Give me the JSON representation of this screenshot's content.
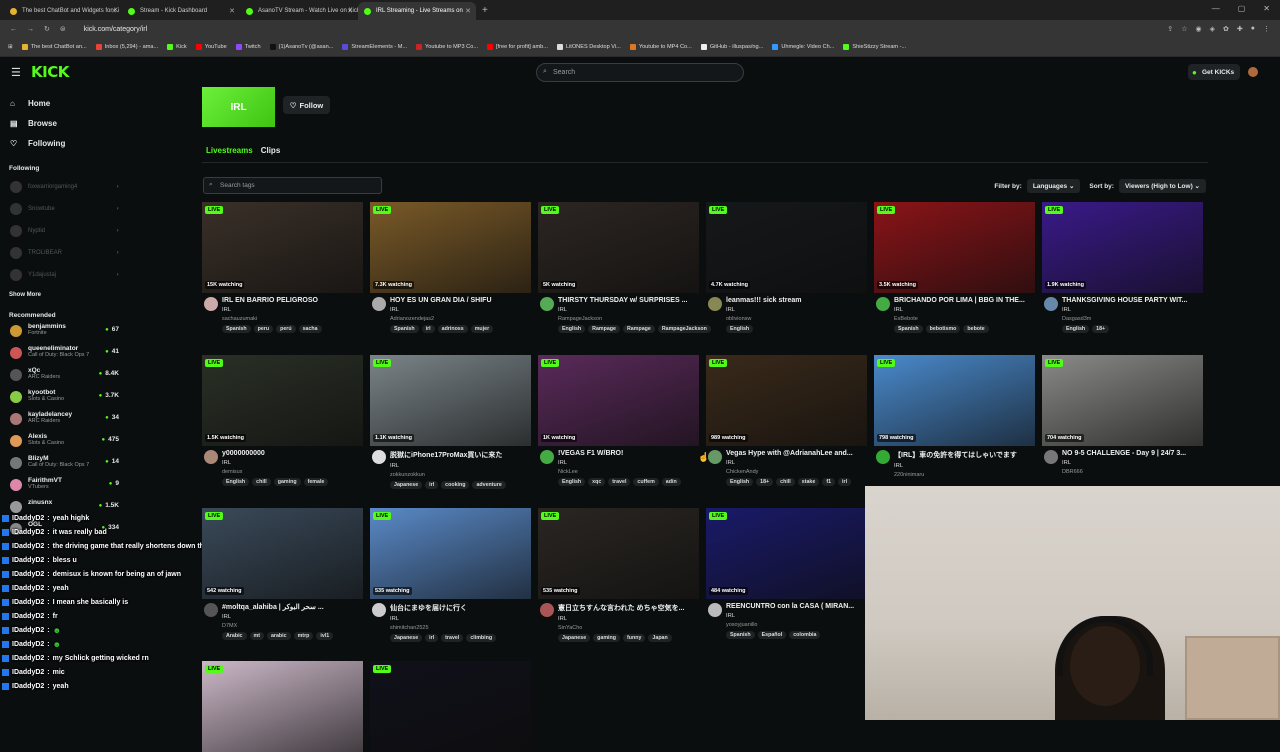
{
  "browser": {
    "tabs": [
      {
        "label": "The best ChatBot and Widgets for Ki",
        "color": "#e7b231"
      },
      {
        "label": "Stream - Kick Dashboard",
        "color": "#53fc18"
      },
      {
        "label": "AsanoTV Stream - Watch Live on Kick",
        "color": "#53fc18"
      },
      {
        "label": "IRL Streaming - Live Streams on",
        "color": "#53fc18",
        "active": true
      }
    ],
    "url": "kick.com/category/irl",
    "bookmarks": [
      {
        "label": "The best ChatBot an...",
        "color": "#e7b231"
      },
      {
        "label": "Inbox (5,294) - ama...",
        "color": "#ea4335"
      },
      {
        "label": "Kick",
        "color": "#53fc18"
      },
      {
        "label": "YouTube",
        "color": "#ff0000"
      },
      {
        "label": "Twitch",
        "color": "#9146ff"
      },
      {
        "label": "(1)AsanoTv (@asan...",
        "color": "#111111"
      },
      {
        "label": "StreamElements - M...",
        "color": "#5a4cd6"
      },
      {
        "label": "Youtube to MP3 Co...",
        "color": "#cc2222"
      },
      {
        "label": "[free for profit] amb...",
        "color": "#ff0000"
      },
      {
        "label": "LitONES Desktop Vi...",
        "color": "#dddddd"
      },
      {
        "label": "Youtube to MP4 Co...",
        "color": "#dd7722"
      },
      {
        "label": "GitHub - illuspas/ng...",
        "color": "#eeeeee"
      },
      {
        "label": "Uhmegle: Video Ch...",
        "color": "#3399ff"
      },
      {
        "label": "ShieStizzy Stream -...",
        "color": "#53fc18"
      }
    ]
  },
  "header": {
    "logo": "KICK",
    "search_placeholder": "Search",
    "get_kicks": "Get KICKs"
  },
  "sidebar": {
    "nav": [
      {
        "label": "Home",
        "icon": "home-icon"
      },
      {
        "label": "Browse",
        "icon": "browse-icon"
      },
      {
        "label": "Following",
        "icon": "heart-icon"
      }
    ],
    "following_title": "Following",
    "following": [
      "foxwarriorgaming4",
      "Snowtube",
      "Nyptid",
      "TROLIBEAR",
      "Y1dajustaj"
    ],
    "show_more": "Show More",
    "recommended_title": "Recommended",
    "recommended": [
      {
        "name": "benjammins",
        "category": "Fortnite",
        "viewers": "67",
        "color": "#c93"
      },
      {
        "name": "queeneliminator",
        "category": "Call of Duty: Black Ops 7",
        "viewers": "41",
        "color": "#c55"
      },
      {
        "name": "xQc",
        "category": "ARC Raiders",
        "viewers": "8.4K",
        "color": "#555"
      },
      {
        "name": "kyootbot",
        "category": "Slots & Casino",
        "viewers": "3.7K",
        "color": "#8c4"
      },
      {
        "name": "kayladelancey",
        "category": "ARC Raiders",
        "viewers": "34",
        "color": "#a77"
      },
      {
        "name": "Alexis",
        "category": "Slots & Casino",
        "viewers": "475",
        "color": "#d95"
      },
      {
        "name": "BlizyM",
        "category": "Call of Duty: Black Ops 7",
        "viewers": "14",
        "color": "#777"
      },
      {
        "name": "FairithmVT",
        "category": "VTubers",
        "viewers": "9",
        "color": "#d8a"
      },
      {
        "name": "zinusnx",
        "category": "",
        "viewers": "1.5K",
        "color": "#999"
      },
      {
        "name": "OGL",
        "category": "",
        "viewers": "334",
        "color": "#888"
      }
    ]
  },
  "chat": [
    {
      "user": "IDaddyD2",
      "msg": "yeah highk"
    },
    {
      "user": "IDaddyD2",
      "msg": "it was really bad"
    },
    {
      "user": "IDaddyD2",
      "msg": "the driving game that really shortens down the list"
    },
    {
      "user": "IDaddyD2",
      "msg": "bless u"
    },
    {
      "user": "IDaddyD2",
      "msg": "demisux is known for being an of jawn"
    },
    {
      "user": "IDaddyD2",
      "msg": "yeah"
    },
    {
      "user": "IDaddyD2",
      "msg": "I mean she basically is"
    },
    {
      "user": "IDaddyD2",
      "msg": "fr"
    },
    {
      "user": "IDaddyD2",
      "msg": "",
      "emote": true
    },
    {
      "user": "IDaddyD2",
      "msg": "",
      "emote": true
    },
    {
      "user": "IDaddyD2",
      "msg": "my Schlick getting wicked rn"
    },
    {
      "user": "IDaddyD2",
      "msg": "mic"
    },
    {
      "user": "IDaddyD2",
      "msg": "yeah"
    }
  ],
  "category": {
    "name": "IRL",
    "follow_label": "Follow",
    "tabs": [
      "Livestreams",
      "Clips"
    ],
    "tag_search_placeholder": "Search tags",
    "filter_by": "Filter by:",
    "languages": "Languages",
    "sort_by": "Sort by:",
    "sort_value": "Viewers (High to Low)"
  },
  "streams": [
    {
      "title": "IRL EN BARRIO PELIGROSO",
      "category": "IRL",
      "streamer": "sachauzumaki",
      "watching": "15K watching",
      "tags": [
        "Spanish",
        "peru",
        "perú",
        "sacha"
      ],
      "bg": "#3a3028",
      "av": "#caa"
    },
    {
      "title": "HOY ES UN GRAN DIA / SHIFU",
      "category": "IRL",
      "streamer": "Adrianozendejas2",
      "watching": "7.3K watching",
      "tags": [
        "Spanish",
        "irl",
        "adrinoss",
        "mujer"
      ],
      "bg": "#7a5a28",
      "av": "#aaa"
    },
    {
      "title": "THIRSTY THURSDAY w/ SURPRISES ...",
      "category": "IRL",
      "streamer": "RampageJackson",
      "watching": "5K watching",
      "tags": [
        "English",
        "Rampage",
        "Rampage",
        "RampageJackson"
      ],
      "bg": "#2c2622",
      "av": "#5a5"
    },
    {
      "title": "leanmas!!! sick stream",
      "category": "IRL",
      "streamer": "oblivionsw",
      "watching": "4.7K watching",
      "tags": [
        "English"
      ],
      "bg": "#15181a",
      "av": "#885"
    },
    {
      "title": "BRICHANDO POR LIMA | BBG IN THE...",
      "category": "IRL",
      "streamer": "EsBebote",
      "watching": "3.5K watching",
      "tags": [
        "Spanish",
        "bebotismo",
        "bebote"
      ],
      "bg": "#8a1418",
      "av": "#4a4"
    },
    {
      "title": "THANKSGIVING HOUSE PARTY WIT...",
      "category": "IRL",
      "streamer": "Dasgasd3m",
      "watching": "1.9K watching",
      "tags": [
        "English",
        "18+"
      ],
      "bg": "#3a1a8a",
      "av": "#68a"
    },
    {
      "title": "y0000000000",
      "category": "IRL",
      "streamer": "demisux",
      "watching": "1.5K watching",
      "tags": [
        "English",
        "chill",
        "gaming",
        "female"
      ],
      "bg": "#2a3026",
      "av": "#a87"
    },
    {
      "title": "脱獄にiPhone17ProMax買いに来た",
      "category": "IRL",
      "streamer": "zokkunzokkun",
      "watching": "1.1K watching",
      "tags": [
        "Japanese",
        "irl",
        "cooking",
        "adventure"
      ],
      "bg": "#7a8488",
      "av": "#ddd"
    },
    {
      "title": "!VEGAS F1 W/BRO!",
      "category": "IRL",
      "streamer": "NickLee",
      "watching": "1K watching",
      "tags": [
        "English",
        "xqc",
        "travel",
        "cuffem",
        "adin"
      ],
      "bg": "#5a2a5a",
      "av": "#4a4"
    },
    {
      "title": "Vegas Hype with @AdrianahLee and...",
      "category": "IRL",
      "streamer": "ChickenAndy",
      "watching": "989 watching",
      "tags": [
        "English",
        "18+",
        "chill",
        "stake",
        "f1",
        "irl"
      ],
      "bg": "#3a2a1a",
      "av": "#696"
    },
    {
      "title": "【IRL】車の免許を得てはしゃいでます",
      "category": "IRL",
      "streamer": "220ninimaru",
      "watching": "798 watching",
      "tags": [],
      "bg": "#4a8acc",
      "av": "#3a3"
    },
    {
      "title": "NO 9-5 CHALLENGE - Day 9 | 24/7 3...",
      "category": "IRL",
      "streamer": "DBR666",
      "watching": "704 watching",
      "tags": [],
      "bg": "#8a8a88",
      "av": "#777"
    },
    {
      "title": "#moltqa_alahiba | سحر البوكر ...",
      "category": "IRL",
      "streamer": "D7MX",
      "watching": "542 watching",
      "tags": [
        "Arabic",
        "mt",
        "arabic",
        "mtrp",
        "ivl1"
      ],
      "bg": "#3a4a5a",
      "av": "#555"
    },
    {
      "title": "仙台にまゆを届けに行く",
      "category": "IRL",
      "streamer": "shimitchan2525",
      "watching": "535 watching",
      "tags": [
        "Japanese",
        "irl",
        "travel",
        "climbing"
      ],
      "bg": "#5a8ac8",
      "av": "#ccc"
    },
    {
      "title": "憲日立ちすんな言われた めちゃ空気を...",
      "category": "IRL",
      "streamer": "SinYaCho",
      "watching": "535 watching",
      "tags": [
        "Japanese",
        "gaming",
        "funny",
        "Japan"
      ],
      "bg": "#2a2622",
      "av": "#a55"
    },
    {
      "title": "REENCUNTRO con la CASA ( MIRAN...",
      "category": "IRL",
      "streamer": "yosoyjuanillo",
      "watching": "484 watching",
      "tags": [
        "Spanish",
        "Español",
        "colombia"
      ],
      "bg": "#1a1a6a",
      "av": "#bbb"
    },
    {
      "title": "",
      "category": "",
      "streamer": "",
      "watching": "",
      "tags": [],
      "bg": "#2a2a26",
      "av": "#333"
    },
    {
      "title": "",
      "category": "",
      "streamer": "",
      "watching": "",
      "tags": [],
      "bg": "#1a1a22",
      "av": "#333"
    },
    {
      "title": "",
      "category": "",
      "streamer": "",
      "watching": "",
      "tags": [],
      "bg": "#ccb8c8",
      "av": "#333"
    },
    {
      "title": "",
      "category": "",
      "streamer": "",
      "watching": "",
      "tags": [],
      "bg": "#10101a",
      "av": "#333"
    }
  ],
  "live_label": "LIVE"
}
